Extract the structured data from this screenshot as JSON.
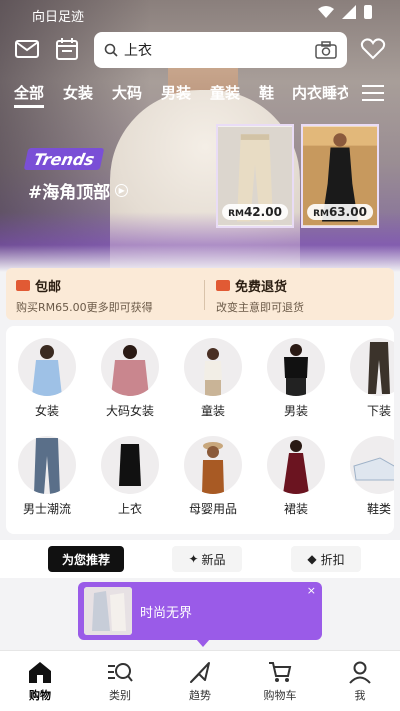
{
  "status_bar": {
    "carrier": "向日足迹"
  },
  "search": {
    "query": "上衣"
  },
  "categories_tabs": [
    "全部",
    "女装",
    "大码",
    "男装",
    "童装",
    "鞋",
    "内衣睡衣"
  ],
  "trends": {
    "badge": "Trends",
    "title": "#海角顶部",
    "products": [
      {
        "currency": "RM",
        "price": "42.00"
      },
      {
        "currency": "RM",
        "price": "63.00"
      }
    ]
  },
  "benefits": [
    {
      "title": "包邮",
      "subtitle": "购买RM65.00更多即可获得"
    },
    {
      "title": "免费退货",
      "subtitle": "改变主意即可退货"
    }
  ],
  "category_grid": [
    {
      "label": "女装"
    },
    {
      "label": "大码女装"
    },
    {
      "label": "童装"
    },
    {
      "label": "男装"
    },
    {
      "label": "下装"
    },
    {
      "label": "男士潮流"
    },
    {
      "label": "上衣"
    },
    {
      "label": "母婴用品"
    },
    {
      "label": "裙装"
    },
    {
      "label": "鞋类"
    }
  ],
  "feed_tabs": [
    {
      "label": "为您推荐",
      "active": true
    },
    {
      "label": "新品",
      "active": false
    },
    {
      "label": "折扣",
      "active": false
    }
  ],
  "promo": {
    "text": "时尚无界",
    "close": "×"
  },
  "bottom_nav": [
    {
      "label": "购物",
      "icon": "home-icon",
      "active": true
    },
    {
      "label": "类别",
      "icon": "category-search-icon",
      "active": false
    },
    {
      "label": "趋势",
      "icon": "trend-arrow-icon",
      "active": false
    },
    {
      "label": "购物车",
      "icon": "cart-icon",
      "active": false
    },
    {
      "label": "我",
      "icon": "profile-icon",
      "active": false
    }
  ],
  "colors": {
    "accent": "#9a5be8",
    "benefit_bg": "#fbead7",
    "benefit_icon": "#e15a34"
  }
}
